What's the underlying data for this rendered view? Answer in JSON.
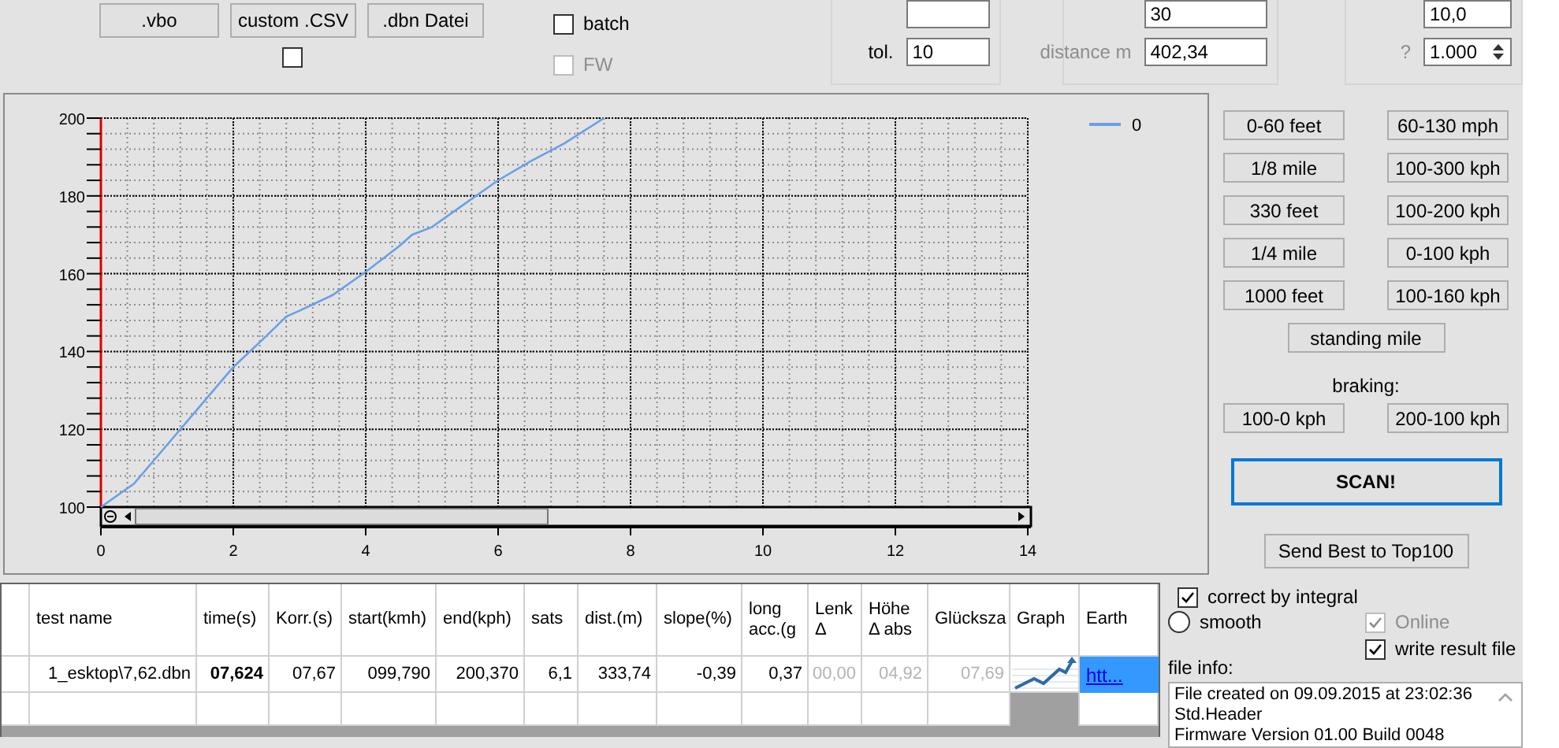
{
  "import_buttons": [
    ".vbo",
    "custom .CSV",
    ".dbn Datei"
  ],
  "import_option": {
    "checked": false
  },
  "batch": {
    "label": "batch",
    "checked": false,
    "disabled": false
  },
  "fw": {
    "label": "FW",
    "checked": false,
    "disabled": true
  },
  "group_1": {
    "tol_label": "tol.",
    "tol_value": "10"
  },
  "group_2": {
    "rollout_value": "30",
    "distance_label": "distance m",
    "distance_value": "402,34"
  },
  "group_3": {
    "time_value": "10,0",
    "factor_label": "?",
    "factor_value": "1.000"
  },
  "chart": {
    "chart_data": {
      "type": "line",
      "x": [
        0,
        0.5,
        1,
        1.5,
        2,
        2.5,
        2.8,
        3,
        3.5,
        4,
        4.5,
        4.7,
        5,
        5.5,
        6,
        6.5,
        7,
        7.6
      ],
      "series": [
        {
          "name": "0",
          "color": "#6a9fe8",
          "values": [
            100,
            106,
            116,
            126,
            136,
            144,
            149,
            150.5,
            154.5,
            160.5,
            167,
            170,
            172,
            178,
            184,
            189,
            193.5,
            200
          ]
        }
      ],
      "grid": true,
      "xlim": [
        0,
        14
      ],
      "ylim": [
        100,
        200
      ],
      "xticks": [
        0,
        2,
        4,
        6,
        8,
        10,
        12,
        14
      ],
      "yticks": [
        100,
        120,
        140,
        160,
        180,
        200
      ]
    }
  },
  "range_buttons": [
    [
      "0-60 feet",
      "60-130 mph"
    ],
    [
      "1/8 mile",
      "100-300 kph"
    ],
    [
      "330 feet",
      "100-200 kph"
    ],
    [
      "1/4 mile",
      "0-100 kph"
    ],
    [
      "1000 feet",
      "100-160 kph"
    ]
  ],
  "standing_mile": "standing mile",
  "braking": {
    "label": "braking:",
    "buttons": [
      "100-0 kph",
      "200-100 kph"
    ]
  },
  "scan_button": "SCAN!",
  "send_button": "Send Best to Top100",
  "table": {
    "columns": [
      "test name",
      "time(s)",
      "Korr.(s)",
      "start(kmh)",
      "end(kph)",
      "sats",
      "dist.(m)",
      "slope(%)",
      "long\nacc.(g",
      "Lenk\nΔ",
      "Höhe\nΔ abs",
      "Glücksza",
      "Graph",
      "Earth"
    ],
    "rows": [
      [
        {
          "kind": "text",
          "text": "1_esktop\\7,62.dbn",
          "bold": false,
          "disabled": false
        },
        {
          "kind": "text",
          "text": "07,624",
          "bold": true,
          "disabled": false
        },
        {
          "kind": "text",
          "text": "07,67",
          "bold": false,
          "disabled": false
        },
        {
          "kind": "text",
          "text": "099,790",
          "bold": false,
          "disabled": false
        },
        {
          "kind": "text",
          "text": "200,370",
          "bold": false,
          "disabled": false
        },
        {
          "kind": "text",
          "text": "6,1",
          "bold": false,
          "disabled": false
        },
        {
          "kind": "text",
          "text": "333,74",
          "bold": false,
          "disabled": false
        },
        {
          "kind": "text",
          "text": "-0,39",
          "bold": false,
          "disabled": false
        },
        {
          "kind": "text",
          "text": "0,37",
          "bold": false,
          "disabled": false
        },
        {
          "kind": "text",
          "text": "00,00",
          "bold": false,
          "disabled": true
        },
        {
          "kind": "text",
          "text": "04,92",
          "bold": false,
          "disabled": true
        },
        {
          "kind": "text",
          "text": "07,69",
          "bold": false,
          "disabled": true
        },
        {
          "kind": "graph"
        },
        {
          "kind": "link",
          "text": "htt..."
        }
      ]
    ]
  },
  "correct_by_integral": {
    "label": "correct by integral",
    "checked": true
  },
  "smooth": {
    "label": "smooth",
    "selected": false
  },
  "online": {
    "label": "Online",
    "checked": true,
    "disabled": true
  },
  "write_result": {
    "label": "write result file",
    "checked": true,
    "disabled": false
  },
  "file_info": {
    "label": "file info:",
    "lines": [
      "File created on 09.09.2015 at 23:02:36",
      "Std.Header",
      "Firmware Version 01.00 Build 0048"
    ]
  }
}
